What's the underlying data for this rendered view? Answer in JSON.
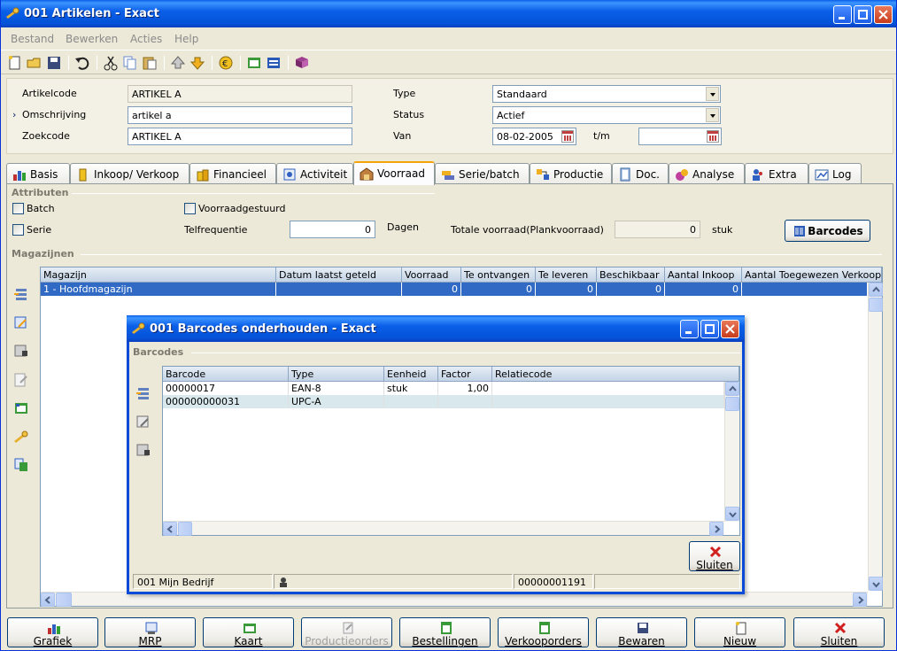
{
  "window": {
    "title": "001 Artikelen - Exact"
  },
  "menu": [
    "Bestand",
    "Bewerken",
    "Acties",
    "Help"
  ],
  "form": {
    "artikelcode_label": "Artikelcode",
    "artikelcode_value": "ARTIKEL A",
    "omschrijving_label": "Omschrijving",
    "omschrijving_value": "artikel a",
    "zoekcode_label": "Zoekcode",
    "zoekcode_value": "ARTIKEL A",
    "type_label": "Type",
    "type_value": "Standaard",
    "status_label": "Status",
    "status_value": "Actief",
    "van_label": "Van",
    "van_value": "08-02-2005",
    "tm_label": "t/m",
    "tm_value": ""
  },
  "tabs": [
    "Basis",
    "Inkoop/ Verkoop",
    "Financieel",
    "Activiteit",
    "Voorraad",
    "Serie/batch",
    "Productie",
    "Doc.",
    "Analyse",
    "Extra",
    "Log"
  ],
  "active_tab": "Voorraad",
  "attributen": {
    "group_label": "Attributen",
    "batch_label": "Batch",
    "serie_label": "Serie",
    "voorraadgestuurd_label": "Voorraadgestuurd",
    "telfrequentie_label": "Telfrequentie",
    "telfrequentie_value": "0",
    "dagen_label": "Dagen",
    "totale_voorraad_label": "Totale voorraad(Plankvoorraad)",
    "totale_voorraad_value": "0",
    "stuk_label": "stuk",
    "barcodes_button": "Barcodes"
  },
  "magazijnen": {
    "group_label": "Magazijnen",
    "columns": [
      "Magazijn",
      "Datum laatst geteld",
      "Voorraad",
      "Te ontvangen",
      "Te leveren",
      "Beschikbaar",
      "Aantal Inkoop",
      "Aantal Toegewezen Verkoop"
    ],
    "rows": [
      [
        "1     - Hoofdmagazijn",
        "",
        "0",
        "0",
        "0",
        "0",
        "0",
        ""
      ]
    ]
  },
  "bottom_buttons": [
    "Grafiek",
    "MRP",
    "Kaart",
    "Productieorders",
    "Bestellingen",
    "Verkooporders",
    "Bewaren",
    "Nieuw",
    "Sluiten"
  ],
  "dialog": {
    "title": "001 Barcodes onderhouden - Exact",
    "group_label": "Barcodes",
    "columns": [
      "Barcode",
      "Type",
      "Eenheid",
      "Factor",
      "Relatiecode"
    ],
    "rows": [
      [
        "00000017",
        "EAN-8",
        "stuk",
        "1,00",
        ""
      ],
      [
        "000000000031",
        "UPC-A",
        "",
        "",
        ""
      ]
    ],
    "close_button": "Sluiten",
    "status_company": "001 Mijn Bedrijf",
    "status_record": "00000001191"
  },
  "colors": {
    "title_blue": "#0a5fe8",
    "selection": "#316ac5",
    "tab_highlight": "#f4a40a"
  }
}
